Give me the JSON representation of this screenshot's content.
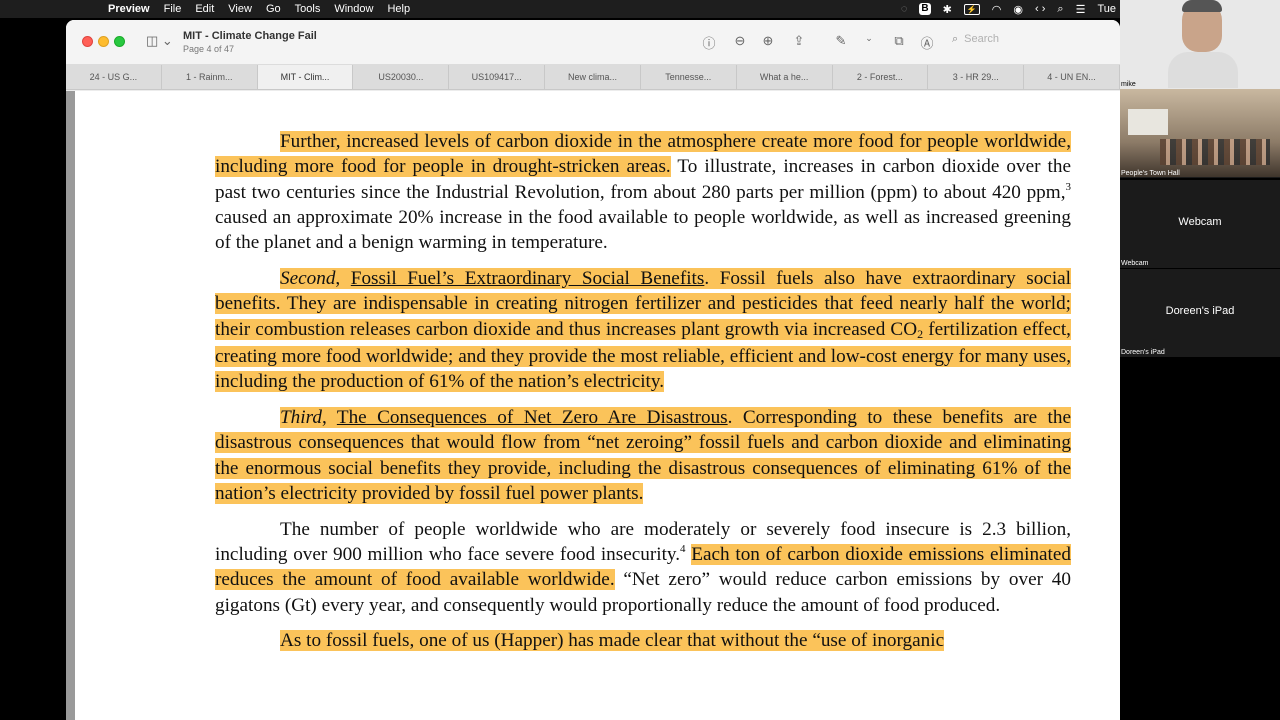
{
  "menubar": {
    "apple": "",
    "app": "Preview",
    "items": [
      "File",
      "Edit",
      "View",
      "Go",
      "Tools",
      "Window",
      "Help"
    ],
    "status": {
      "b_badge": "B",
      "bt": "✱",
      "wifi": "◠",
      "clock_text": "Tue"
    }
  },
  "window": {
    "title": "MIT - Climate Change Fail",
    "subtitle": "Page 4 of 47",
    "search_placeholder": "Search",
    "icons": [
      "info-icon",
      "zoom-out-icon",
      "zoom-in-icon",
      "share-icon",
      "markup-pen-icon",
      "chevron-down-icon",
      "rotate-icon",
      "annotate-icon",
      "search-icon"
    ]
  },
  "tabs": [
    {
      "label": "24 - US G..."
    },
    {
      "label": "1 - Rainm..."
    },
    {
      "label": "MIT - Clim..."
    },
    {
      "label": "US20030..."
    },
    {
      "label": "US109417..."
    },
    {
      "label": "New clima..."
    },
    {
      "label": "Tennesse..."
    },
    {
      "label": "What a he..."
    },
    {
      "label": "2 - Forest..."
    },
    {
      "label": "3 - HR 29..."
    },
    {
      "label": "4 - UN EN..."
    }
  ],
  "document": {
    "p1": {
      "hl": "Further, increased levels of carbon dioxide in the atmosphere create more food for people worldwide, including more food for people in drought-stricken areas.",
      "rest_a": "  To illustrate, increases in carbon dioxide over the past two centuries since the Industrial Revolution, from about 280 parts per million (ppm) to about 420 ppm,",
      "fn": "3",
      "rest_b": " caused an approximate 20% increase in the food available to people worldwide, as well as increased greening of the planet and a benign warming in temperature."
    },
    "p2": {
      "italic": "Second",
      "comma": ", ",
      "underline": "Fossil Fuel’s Extraordinary Social Benefits",
      "a": ".  Fossil fuels also have extraordinary social benefits.  They are indispensable in creating nitrogen fertilizer and pesticides that feed nearly half the world; their combustion releases carbon dioxide and thus increases plant growth via increased CO",
      "sub": "2",
      "b": " fertilization effect, creating more food worldwide; and they provide the most reliable, efficient and low-cost energy for many uses, including the production of 61% of the nation’s electricity."
    },
    "p3": {
      "italic": "Third",
      "comma": ", ",
      "underline": "The Consequences of Net Zero Are Disastrous",
      "a": ".  Corresponding to these benefits are the disastrous consequences that would flow from “net zeroing” fossil fuels and carbon dioxide and eliminating the enormous social benefits they provide, including the disastrous consequences of eliminating 61% of the nation’s electricity provided by fossil fuel power plants."
    },
    "p4": {
      "a": "The number of people worldwide who are moderately or severely food insecure is 2.3 billion, including over 900 million who face severe food insecurity.",
      "fn": "4",
      "gap": "  ",
      "hl": "Each ton of carbon dioxide emissions eliminated reduces the amount of food available worldwide.",
      "b": "  “Net zero” would reduce carbon emissions by over 40 gigatons (Gt) every year, and consequently would proportionally reduce the amount of food produced."
    },
    "p5": {
      "hl": "As to fossil fuels, one of us (Happer) has made clear that without the “use of inorganic"
    }
  },
  "zoom": {
    "tile1_label": "mike",
    "tile2_label": "People's Town Hall",
    "tile3_center": "Webcam",
    "tile3_label": "Webcam",
    "tile4_center": "Doreen's iPad",
    "tile4_label": "Doreen's iPad"
  },
  "colors": {
    "highlight": "#fbc35a",
    "menubar": "#1e1e1e"
  }
}
